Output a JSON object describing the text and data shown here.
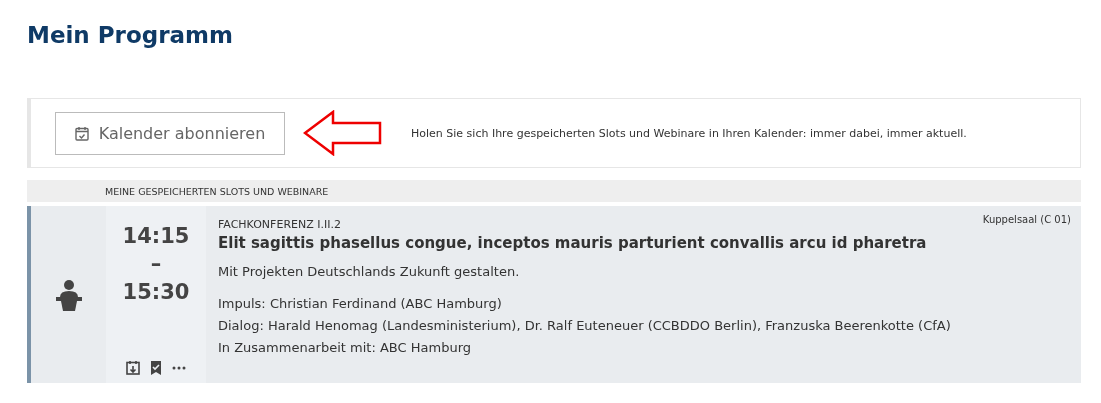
{
  "page_title": "Mein Programm",
  "calendar": {
    "button": "Kalender abonnieren",
    "hint": "Holen Sie sich Ihre gespeicherten Slots und Webinare in Ihren Kalender: immer dabei, immer aktuell."
  },
  "section_header": "MEINE GESPEICHERTEN SLOTS UND WEBINARE",
  "slots": [
    {
      "start": "14:15",
      "separator": "–",
      "end": "15:30",
      "category": "FACHKONFERENZ I.II.2",
      "title": "Elit sagittis phasellus congue, inceptos mauris parturient convallis arcu id pharetra",
      "subtitle": "Mit Projekten Deutschlands Zukunft gestalten.",
      "room": "Kuppelsaal (C 01)",
      "details": [
        "Impuls: Christian Ferdinand (ABC Hamburg)",
        "Dialog: Harald Henomag (Landesministerium), Dr. Ralf Euteneuer (CCBDDO Berlin), Franzuska Beerenkotte (CfA)",
        "In Zusammenarbeit mit: ABC Hamburg"
      ]
    }
  ]
}
